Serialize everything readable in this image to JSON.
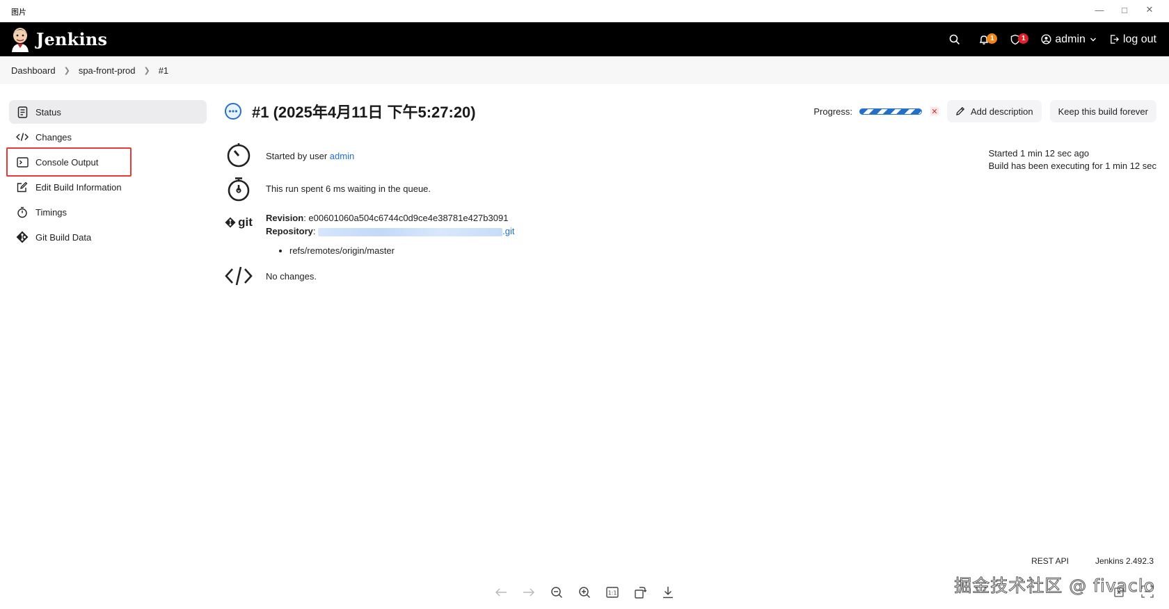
{
  "window": {
    "title": "图片"
  },
  "header": {
    "brand": "Jenkins",
    "notifications_count": "1",
    "security_count": "1",
    "user": "admin",
    "logout_label": "log out"
  },
  "breadcrumb": [
    "Dashboard",
    "spa-front-prod",
    "#1"
  ],
  "sidebar": {
    "items": [
      {
        "label": "Status"
      },
      {
        "label": "Changes"
      },
      {
        "label": "Console Output"
      },
      {
        "label": "Edit Build Information"
      },
      {
        "label": "Timings"
      },
      {
        "label": "Git Build Data"
      }
    ]
  },
  "build": {
    "title": "#1 (2025年4月11日 下午5:27:20)",
    "progress_label": "Progress:",
    "add_description": "Add description",
    "keep_forever": "Keep this build forever",
    "started_by_prefix": "Started by user",
    "started_by_user": "admin",
    "queue_text": "This run spent 6 ms waiting in the queue.",
    "revision_label": "Revision",
    "revision_value": "e00601060a504c6744c0d9ce4e38781e427b3091",
    "repository_label": "Repository",
    "repository_suffix": ".git",
    "git_label": "git",
    "ref": "refs/remotes/origin/master",
    "changes_text": "No changes.",
    "started_ago": "Started 1 min 12 sec ago",
    "executing_for": "Build has been executing for 1 min 12 sec"
  },
  "footer": {
    "rest_api": "REST API",
    "version": "Jenkins 2.492.3"
  },
  "watermark": "掘金技术社区 @ fivaclo",
  "colors": {
    "link": "#1f6fd1",
    "header_bg": "#000000",
    "highlight": "#e53935",
    "badge_orange": "#f0861a",
    "badge_red": "#e0202b"
  }
}
